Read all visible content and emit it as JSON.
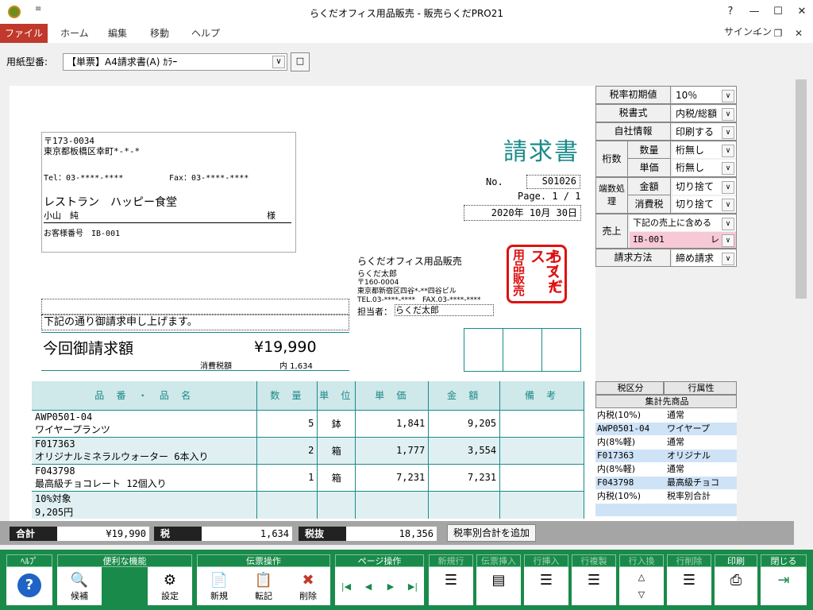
{
  "window": {
    "title": "らくだオフィス用品販売 - 販売らくだPRO21",
    "qat_glyph": "≡",
    "help_btn": "?",
    "min_btn": "—",
    "max_btn": "☐",
    "close_btn": "✕"
  },
  "menubar": {
    "file": "ファイル",
    "items": [
      "ホーム",
      "編集",
      "移動",
      "ヘルプ"
    ],
    "signin": "サインイン",
    "min": "—",
    "restore": "❐",
    "close": "✕"
  },
  "form": {
    "label": "用紙型番:",
    "value": "【単票】A4請求書(A) ｶﾗｰ",
    "button": "□"
  },
  "doc": {
    "title": "請求書",
    "customer": {
      "postal": "〒173-0034",
      "address": "東京都板橋区幸町*-*-*",
      "tel": "Tel：03-****-****",
      "fax": "Fax：03-****-****",
      "name": "レストラン　ハッピー食堂",
      "contact": "小山　純",
      "honorific": "様",
      "number": "お客様番号　IB-001"
    },
    "no_label": "No.",
    "no_value": "S01026",
    "page": "Page. 1 / 1",
    "date": "2020年 10月 30日",
    "company": {
      "name": "らくだオフィス用品販売",
      "person": "らくだ太郎",
      "postal": "〒160-0004",
      "address": "東京都新宿区四谷*-**四谷ビル",
      "telfax": "TEL.03-****-****　FAX.03-****-****",
      "staff_label": "担当者：",
      "staff": "らくだ太郎"
    },
    "stamp": [
      "らくだ",
      "オフィス",
      "用品販売"
    ],
    "notice": "下記の通り御請求申し上げます。",
    "billing": {
      "label": "今回御請求額",
      "amount": "¥19,990",
      "tax_label": "消費税額",
      "tax_value": "内 1,634"
    },
    "headers": [
      "品 番 ・ 品 名",
      "数 量",
      "単 位",
      "単 価",
      "金 額",
      "備 考"
    ],
    "rows": [
      {
        "code": "AWP0501-04",
        "name": "ワイヤープランツ",
        "qty": "5",
        "unit": "鉢",
        "price": "1,841",
        "amount": "9,205"
      },
      {
        "code": "F017363",
        "name": "オリジナルミネラルウォーター 6本入り",
        "qty": "2",
        "unit": "箱",
        "price": "1,777",
        "amount": "3,554"
      },
      {
        "code": "F043798",
        "name": "最高級チョコレート 12個入り",
        "qty": "1",
        "unit": "箱",
        "price": "7,231",
        "amount": "7,231"
      },
      {
        "code": "10%対象",
        "name": "9,205円",
        "qty": "",
        "unit": "",
        "price": "",
        "amount": ""
      }
    ]
  },
  "side": {
    "tax_default": {
      "label": "税率初期値",
      "value": "10％"
    },
    "tax_type": {
      "label": "税書式",
      "value": "内税/総額"
    },
    "company_info": {
      "label": "自社情報",
      "value": "印刷する"
    },
    "digits": {
      "label": "桁数",
      "qty_label": "数量",
      "qty_value": "桁無し",
      "price_label": "単価",
      "price_value": "桁無し"
    },
    "rounding": {
      "label": "端数処理",
      "amt_label": "金額",
      "amt_value": "切り捨て",
      "tax_label": "消費税",
      "tax_value": "切り捨て"
    },
    "sales": {
      "label": "売上",
      "value": "下記の売上に含める",
      "code": "IB-001",
      "code_suffix": "レ"
    },
    "billing_method": {
      "label": "請求方法",
      "value": "締め請求"
    },
    "arrow": "∨"
  },
  "grid": {
    "h1": "税区分",
    "h2": "行属性",
    "h3": "集計先商品",
    "rows": [
      {
        "a": "内税(10%)",
        "b": "通常"
      },
      {
        "a": "AWP0501-04",
        "b": "ワイヤープ"
      },
      {
        "a": "内(8%軽)",
        "b": "通常"
      },
      {
        "a": "F017363",
        "b": "オリジナル"
      },
      {
        "a": "内(8%軽)",
        "b": "通常"
      },
      {
        "a": "F043798",
        "b": "最高級チョコ"
      },
      {
        "a": "内税(10%)",
        "b": "税率別合計"
      }
    ]
  },
  "totals": {
    "sum_label": "合計",
    "sum": "¥19,990",
    "tax_label": "税",
    "tax": "1,634",
    "ex_label": "税抜",
    "ex": "18,356",
    "add_button": "税率別合計を追加"
  },
  "toolbar": {
    "help": {
      "head": "ﾍﾙﾌﾟ",
      "icon": "?"
    },
    "useful": {
      "head": "便利な機能",
      "b1": "候補",
      "b3": "設定"
    },
    "slip": {
      "head": "伝票操作",
      "b1": "新規",
      "b2": "転記",
      "b3": "削除"
    },
    "page": {
      "head": "ページ操作",
      "first": "|◀",
      "prev": "◀",
      "next": "▶",
      "last": "▶|"
    },
    "newrow": {
      "head": "新規行"
    },
    "slipins": {
      "head": "伝票挿入"
    },
    "rowins": {
      "head": "行挿入"
    },
    "rowcopy": {
      "head": "行複製"
    },
    "rowswap": {
      "head": "行入換",
      "up": "△",
      "down": "▽"
    },
    "rowdel": {
      "head": "行削除"
    },
    "print": {
      "head": "印刷"
    },
    "close": {
      "head": "閉じる"
    }
  }
}
